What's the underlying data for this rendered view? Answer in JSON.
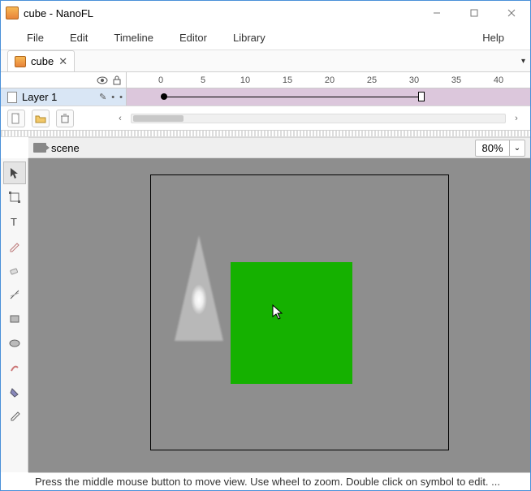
{
  "window": {
    "title": "cube - NanoFL"
  },
  "menu": {
    "file": "File",
    "edit": "Edit",
    "timeline": "Timeline",
    "editor": "Editor",
    "library": "Library",
    "help": "Help"
  },
  "tab": {
    "label": "cube"
  },
  "timeline": {
    "layer_name": "Layer 1",
    "ticks": [
      "0",
      "5",
      "10",
      "15",
      "20",
      "25",
      "30",
      "35",
      "40"
    ]
  },
  "scene": {
    "label": "scene",
    "zoom": "80%"
  },
  "status": {
    "text": "Press the middle mouse button to move view. Use wheel to zoom. Double click on symbol to edit. ..."
  },
  "colors": {
    "green": "#15b100"
  }
}
